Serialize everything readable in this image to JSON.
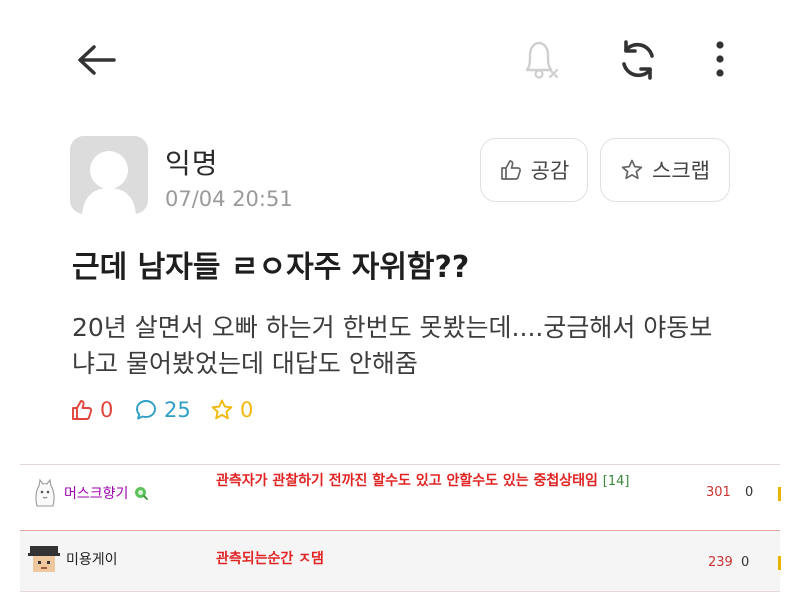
{
  "header": {
    "back_icon": "arrow-left-icon",
    "bell_icon": "bell-off-icon",
    "refresh_icon": "refresh-icon",
    "more_icon": "more-vertical-icon"
  },
  "post": {
    "author": "익명",
    "time": "07/04 20:51",
    "like_button": "공감",
    "scrap_button": "스크랩",
    "title": "근데 남자들 ㄹㅇ자주 자위함??",
    "body": "20년 살면서 오빠 하는거 한번도 못봤는데....궁금해서 야동보냐고 물어봤었는데 대답도 안해줌",
    "stats": {
      "likes": "0",
      "comments": "25",
      "scraps": "0"
    }
  },
  "comments": [
    {
      "author": "머스크향기",
      "text": "관측자가 관찰하기 전까진 할수도 있고 안할수도 있는 중첩상태임",
      "reply_count": "[14]",
      "count": "301",
      "extra": "0"
    },
    {
      "author": "미용게이",
      "text": "관측되는순간 ㅈ댐",
      "count": "239",
      "extra": "0"
    }
  ],
  "colors": {
    "like_red": "#e0443c",
    "comment_blue": "#2f9fc6",
    "scrap_yellow": "#f2b80d",
    "comment_text_red": "#e02424"
  }
}
